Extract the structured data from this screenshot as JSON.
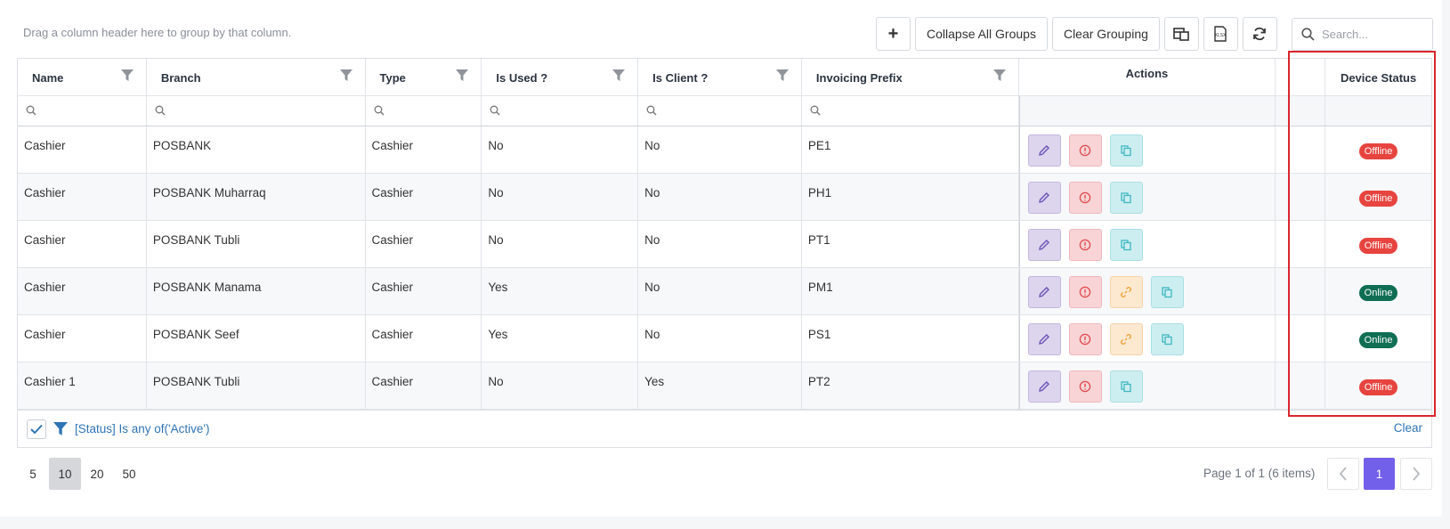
{
  "group_hint": "Drag a column header here to group by that column.",
  "toolbar": {
    "add_label": "+",
    "collapse_label": "Collapse All Groups",
    "clear_grouping_label": "Clear Grouping"
  },
  "search": {
    "placeholder": "Search..."
  },
  "columns": [
    "Name",
    "Branch",
    "Type",
    "Is Used ?",
    "Is Client ?",
    "Invoicing Prefix",
    "Actions",
    "Device Status"
  ],
  "rows": [
    {
      "name": "Cashier",
      "branch": "POSBANK",
      "type": "Cashier",
      "is_used": "No",
      "is_client": "No",
      "prefix": "PE1",
      "status": "Offline"
    },
    {
      "name": "Cashier",
      "branch": "POSBANK Muharraq",
      "type": "Cashier",
      "is_used": "No",
      "is_client": "No",
      "prefix": "PH1",
      "status": "Offline"
    },
    {
      "name": "Cashier",
      "branch": "POSBANK Tubli",
      "type": "Cashier",
      "is_used": "No",
      "is_client": "No",
      "prefix": "PT1",
      "status": "Offline"
    },
    {
      "name": "Cashier",
      "branch": "POSBANK Manama",
      "type": "Cashier",
      "is_used": "Yes",
      "is_client": "No",
      "prefix": "PM1",
      "status": "Online"
    },
    {
      "name": "Cashier",
      "branch": "POSBANK Seef",
      "type": "Cashier",
      "is_used": "Yes",
      "is_client": "No",
      "prefix": "PS1",
      "status": "Online"
    },
    {
      "name": "Cashier 1",
      "branch": "POSBANK Tubli",
      "type": "Cashier",
      "is_used": "No",
      "is_client": "Yes",
      "prefix": "PT2",
      "status": "Offline"
    }
  ],
  "filter": {
    "text": "[Status] Is any of('Active')",
    "clear_label": "Clear"
  },
  "pager": {
    "sizes": [
      "5",
      "10",
      "20",
      "50"
    ],
    "active_size": "10",
    "info": "Page 1 of 1 (6 items)",
    "current_page": "1"
  },
  "colors": {
    "accent": "#7260ea",
    "offline": "#e7443f",
    "online": "#0f6e53",
    "highlight": "#d9262c"
  }
}
